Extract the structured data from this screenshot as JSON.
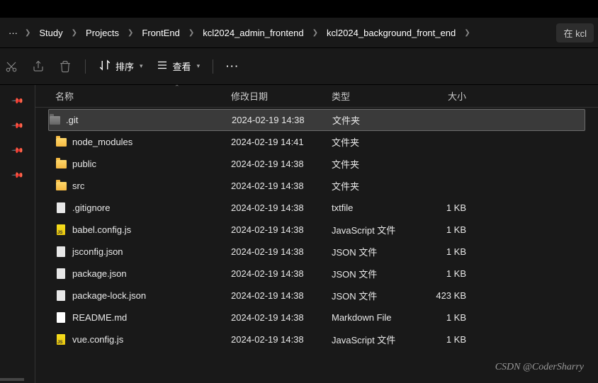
{
  "breadcrumb": {
    "ellipsis": "···",
    "items": [
      "Study",
      "Projects",
      "FrontEnd",
      "kcl2024_admin_frontend",
      "kcl2024_background_front_end"
    ]
  },
  "search": {
    "placeholder": "在 kcl"
  },
  "toolbar": {
    "sort_label": "排序",
    "view_label": "查看",
    "more": "···"
  },
  "columns": {
    "name": "名称",
    "date": "修改日期",
    "type": "类型",
    "size": "大小"
  },
  "files": [
    {
      "name": ".git",
      "date": "2024-02-19 14:38",
      "type": "文件夹",
      "size": "",
      "icon": "folder-dark",
      "selected": true
    },
    {
      "name": "node_modules",
      "date": "2024-02-19 14:41",
      "type": "文件夹",
      "size": "",
      "icon": "folder"
    },
    {
      "name": "public",
      "date": "2024-02-19 14:38",
      "type": "文件夹",
      "size": "",
      "icon": "folder"
    },
    {
      "name": "src",
      "date": "2024-02-19 14:38",
      "type": "文件夹",
      "size": "",
      "icon": "folder"
    },
    {
      "name": ".gitignore",
      "date": "2024-02-19 14:38",
      "type": "txtfile",
      "size": "1 KB",
      "icon": "file"
    },
    {
      "name": "babel.config.js",
      "date": "2024-02-19 14:38",
      "type": "JavaScript 文件",
      "size": "1 KB",
      "icon": "file-js"
    },
    {
      "name": "jsconfig.json",
      "date": "2024-02-19 14:38",
      "type": "JSON 文件",
      "size": "1 KB",
      "icon": "file"
    },
    {
      "name": "package.json",
      "date": "2024-02-19 14:38",
      "type": "JSON 文件",
      "size": "1 KB",
      "icon": "file"
    },
    {
      "name": "package-lock.json",
      "date": "2024-02-19 14:38",
      "type": "JSON 文件",
      "size": "423 KB",
      "icon": "file"
    },
    {
      "name": "README.md",
      "date": "2024-02-19 14:38",
      "type": "Markdown File",
      "size": "1 KB",
      "icon": "file-md"
    },
    {
      "name": "vue.config.js",
      "date": "2024-02-19 14:38",
      "type": "JavaScript 文件",
      "size": "1 KB",
      "icon": "file-js"
    }
  ],
  "watermark": "CSDN @CoderSharry"
}
